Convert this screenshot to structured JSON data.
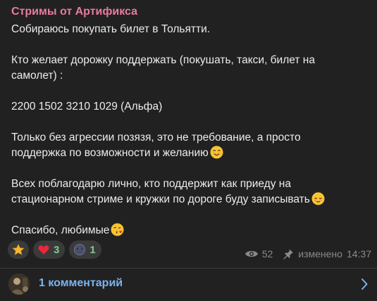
{
  "post": {
    "channel_name": "Стримы от Артификса",
    "lines": [
      "Собираюсь покупать билет в Тольятти.",
      "",
      "Кто желает дорожку поддержать (покушать, такси, билет на",
      "самолет) :",
      "",
      "2200 1502 3210 1029 (Альфа)",
      "",
      "Только без агрессии позязя, это не требование, а просто",
      "поддержка по возможности и желанию",
      "",
      "Всех поблагодарю лично, кто поддержит как приеду на",
      "стационарном стриме и кружки по дороге буду записывать",
      "",
      "Спасибо, любимые"
    ]
  },
  "emojis": {
    "line_8": "smiling-face-emoji",
    "line_11": "relieved-face-emoji",
    "line_13": "face-blowing-kiss-emoji"
  },
  "reactions": [
    {
      "icon": "star-icon",
      "count": ""
    },
    {
      "icon": "red-heart-icon",
      "count": "3"
    },
    {
      "icon": "new-moon-face-icon",
      "count": "1"
    }
  ],
  "meta": {
    "views": "52",
    "edited_label": "изменено",
    "time": "14:37"
  },
  "comments": {
    "label": "1 комментарий"
  },
  "colors": {
    "channel_name": "#e87ba0",
    "comments_link": "#7cb3ee",
    "reaction_count": "#7ec98f",
    "background": "#212121"
  }
}
